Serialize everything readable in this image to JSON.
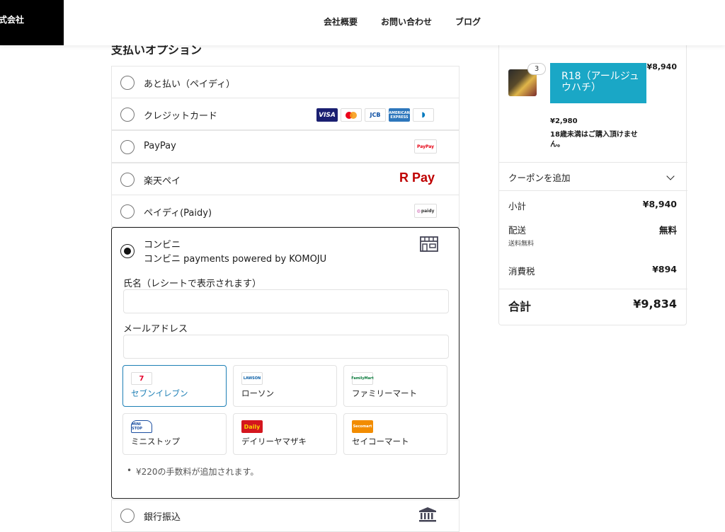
{
  "header": {
    "logo_text": "式会社",
    "nav": [
      "会社概要",
      "お問い合わせ",
      "ブログ"
    ]
  },
  "payment": {
    "section_title": "支払いオプション",
    "options": [
      {
        "label": "あと払い（ペイディ）"
      },
      {
        "label": "クレジットカード",
        "logos": [
          "VISA",
          "Mastercard",
          "JCB",
          "AMERICAN EXPRESS",
          "Diners"
        ]
      },
      {
        "label": "PayPay",
        "logo": "PayPay"
      },
      {
        "label": "楽天ペイ",
        "logo": "R Pay"
      },
      {
        "label": "ペイディ(Paidy)",
        "logo": "paidy"
      }
    ],
    "konbini": {
      "title": "コンビニ",
      "subtitle": "コンビニ payments powered by KOMOJU",
      "icon": "store-icon",
      "name_label": "氏名（レシートで表示されます）",
      "name_value": "",
      "email_label": "メールアドレス",
      "email_value": "",
      "stores": [
        {
          "name": "セブンイレブン",
          "logo": "7",
          "selected": true
        },
        {
          "name": "ローソン",
          "logo": "LAWSON",
          "selected": false
        },
        {
          "name": "ファミリーマート",
          "logo": "FamilyMart",
          "selected": false
        },
        {
          "name": "ミニストップ",
          "logo": "MINI STOP",
          "selected": false
        },
        {
          "name": "デイリーヤマザキ",
          "logo": "Daily",
          "selected": false
        },
        {
          "name": "セイコーマート",
          "logo": "Secomart",
          "selected": false
        }
      ],
      "fee_note": "¥220の手数料が追加されます。"
    },
    "bank": {
      "label": "銀行振込",
      "icon": "bank-icon"
    }
  },
  "summary": {
    "item": {
      "quantity": "3",
      "title": "R18（アールジュウハチ）",
      "line_price": "¥8,940",
      "unit_price": "¥2,980",
      "note": "18歳未満はご購入頂けません。"
    },
    "coupon_label": "クーポンを追加",
    "subtotal_label": "小計",
    "subtotal": "¥8,940",
    "shipping_label": "配送",
    "shipping": "無料",
    "shipping_note": "送料無料",
    "tax_label": "消費税",
    "tax": "¥894",
    "total_label": "合計",
    "total": "¥9,834"
  },
  "colors": {
    "accent": "#1aa7c6",
    "selected_border": "#1d7fb5",
    "rakuten_red": "#bf0000"
  }
}
